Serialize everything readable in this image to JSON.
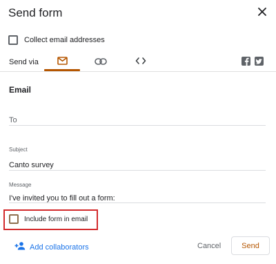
{
  "dialog": {
    "title": "Send form"
  },
  "collect_email": {
    "label": "Collect email addresses",
    "checked": false
  },
  "send_via": {
    "label": "Send via",
    "tabs": [
      {
        "icon": "email-icon",
        "selected": true
      },
      {
        "icon": "link-icon",
        "selected": false
      },
      {
        "icon": "embed-code-icon",
        "selected": false
      }
    ],
    "share_icons": [
      "facebook-icon",
      "twitter-icon"
    ]
  },
  "email_section": {
    "title": "Email",
    "to": {
      "value": "",
      "placeholder": "To"
    },
    "subject": {
      "label": "Subject",
      "value": "Canto survey"
    },
    "message": {
      "label": "Message",
      "value": "I've invited you to fill out a form:"
    },
    "include_form": {
      "label": "Include form in email",
      "checked": false
    }
  },
  "footer": {
    "add_collaborators": "Add collaborators",
    "cancel": "Cancel",
    "send": "Send"
  },
  "colors": {
    "accent": "#b55600",
    "link": "#1a73e8",
    "highlight_box": "#d3292b"
  }
}
